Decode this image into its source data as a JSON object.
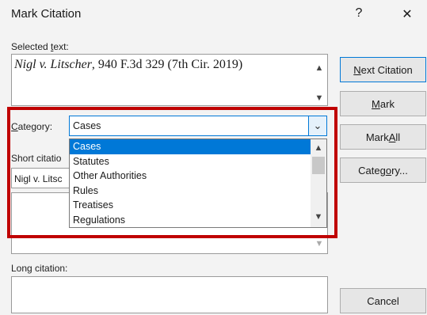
{
  "dialog": {
    "title": "Mark Citation",
    "help_label": "?",
    "close_label": "✕"
  },
  "selected_text": {
    "label_pre": "Selected ",
    "label_ul": "t",
    "label_post": "ext:",
    "case_name": "Nigl v. Litscher",
    "citation_rest": ", 940 F.3d 329 (7th Cir. 2019)"
  },
  "category": {
    "label_ul": "C",
    "label_post": "ategory:",
    "selected_value": "Cases",
    "options": [
      "Cases",
      "Statutes",
      "Other Authorities",
      "Rules",
      "Treatises",
      "Regulations"
    ]
  },
  "short_citation": {
    "label": "Short citatio",
    "value": "Nigl v. Litsc"
  },
  "long_citation": {
    "label": "Long citation:"
  },
  "buttons": {
    "next_citation": {
      "ul": "N",
      "post": "ext Citation"
    },
    "mark": {
      "ul": "M",
      "post": "ark"
    },
    "mark_all": {
      "pre": "Mark ",
      "ul": "A",
      "post": "ll"
    },
    "category": {
      "pre": "Categ",
      "ul": "o",
      "post": "ry..."
    },
    "cancel": "Cancel"
  },
  "icons": {
    "up": "▲",
    "down": "▼",
    "combo": "⌄"
  },
  "colors": {
    "highlight": "#c00000",
    "selection": "#0078d7"
  }
}
